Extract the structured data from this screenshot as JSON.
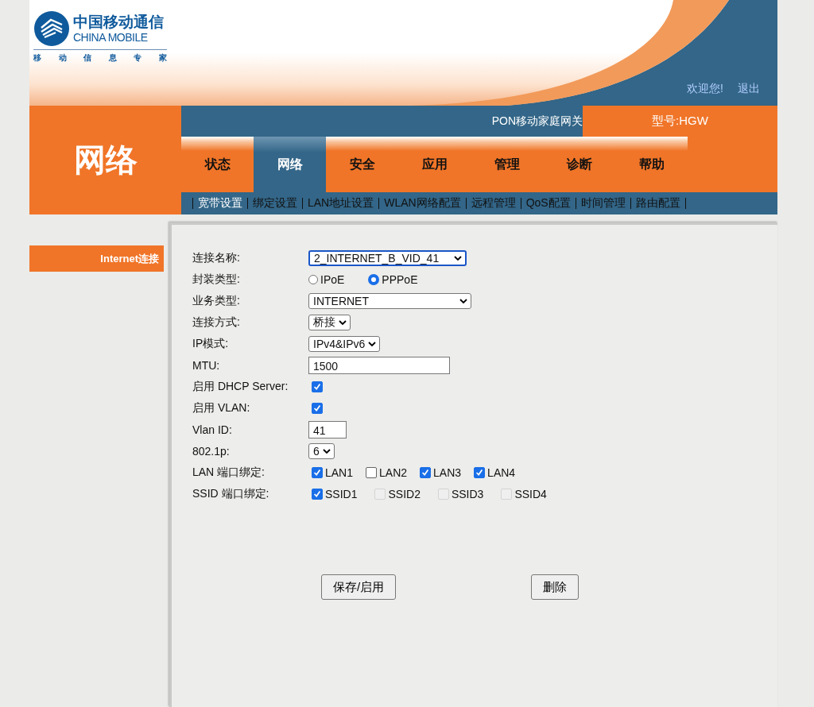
{
  "header": {
    "logo": {
      "name_cn": "中国移动通信",
      "name_en": "CHINA MOBILE",
      "slogan": [
        "移",
        "动",
        "信",
        "息",
        "专",
        "家"
      ]
    },
    "welcome": "欢迎您!",
    "logout": "退出"
  },
  "product": {
    "title": "PON移动家庭网关",
    "model": "型号:HGW"
  },
  "section_title": "网络",
  "tabs": [
    {
      "label": "状态",
      "selected": false
    },
    {
      "label": "网络",
      "selected": true
    },
    {
      "label": "安全",
      "selected": false
    },
    {
      "label": "应用",
      "selected": false
    },
    {
      "label": "管理",
      "selected": false
    },
    {
      "label": "诊断",
      "selected": false
    },
    {
      "label": "帮助",
      "selected": false
    }
  ],
  "subtabs": [
    {
      "label": "宽带设置",
      "selected": true
    },
    {
      "label": "绑定设置",
      "selected": false
    },
    {
      "label": "LAN地址设置",
      "selected": false
    },
    {
      "label": "WLAN网络配置",
      "selected": false
    },
    {
      "label": "远程管理",
      "selected": false
    },
    {
      "label": "QoS配置",
      "selected": false
    },
    {
      "label": "时间管理",
      "selected": false
    },
    {
      "label": "路由配置",
      "selected": false
    }
  ],
  "sidebar": {
    "items": [
      {
        "label": "Internet连接",
        "selected": true
      }
    ]
  },
  "form": {
    "rows": [
      {
        "kind": "select",
        "label": "连接名称:",
        "value": "2_INTERNET_B_VID_41",
        "focused": true
      },
      {
        "kind": "radio",
        "label": "封装类型:",
        "options": [
          {
            "label": "IPoE",
            "selected": false
          },
          {
            "label": "PPPoE",
            "selected": true
          }
        ]
      },
      {
        "kind": "select",
        "label": "业务类型:",
        "value": "INTERNET",
        "focused": false
      },
      {
        "kind": "select",
        "label": "连接方式:",
        "value": "桥接",
        "focused": false
      },
      {
        "kind": "select",
        "label": "IP模式:",
        "value": "IPv4&IPv6",
        "focused": false
      },
      {
        "kind": "text",
        "label": "MTU:",
        "value": "1500"
      },
      {
        "kind": "checkbox",
        "label": "启用 DHCP Server:",
        "checked": true
      },
      {
        "kind": "checkbox",
        "label": "启用 VLAN:",
        "checked": true
      },
      {
        "kind": "text",
        "label": "Vlan ID:",
        "value": "41"
      },
      {
        "kind": "select",
        "label": "802.1p:",
        "value": "6",
        "focused": false
      },
      {
        "kind": "checkgroup",
        "label": "LAN 端口绑定:",
        "options": [
          {
            "label": "LAN1",
            "checked": true,
            "disabled": false
          },
          {
            "label": "LAN2",
            "checked": false,
            "disabled": false
          },
          {
            "label": "LAN3",
            "checked": true,
            "disabled": false
          },
          {
            "label": "LAN4",
            "checked": true,
            "disabled": false
          }
        ]
      },
      {
        "kind": "checkgroup",
        "label": "SSID 端口绑定:",
        "options": [
          {
            "label": "SSID1",
            "checked": true,
            "disabled": false
          },
          {
            "label": "SSID2",
            "checked": false,
            "disabled": true
          },
          {
            "label": "SSID3",
            "checked": false,
            "disabled": true
          },
          {
            "label": "SSID4",
            "checked": false,
            "disabled": true
          }
        ]
      }
    ]
  },
  "buttons": [
    {
      "label": "保存/启用"
    },
    {
      "label": "删除"
    }
  ]
}
